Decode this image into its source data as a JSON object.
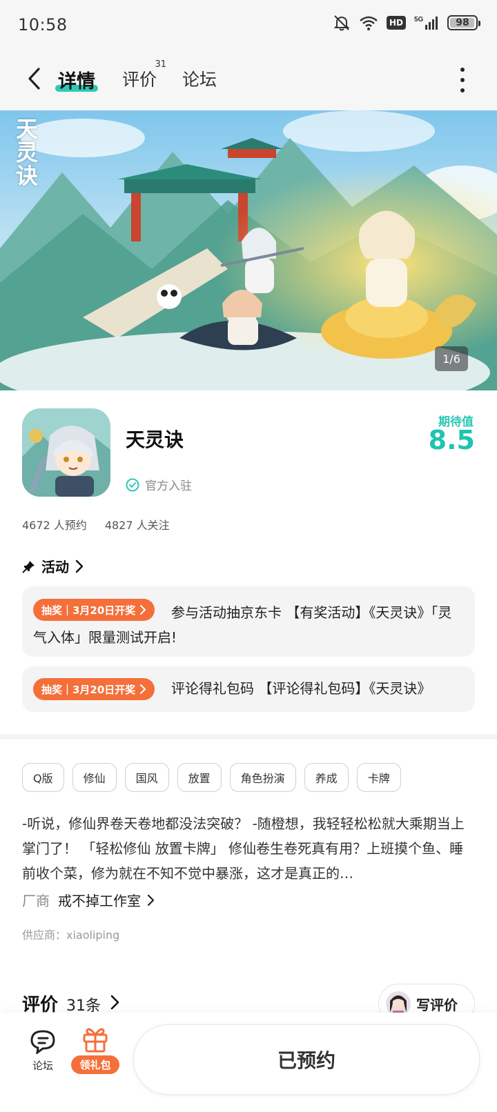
{
  "status_bar": {
    "time": "10:58",
    "network": "5G",
    "hd_label": "HD",
    "battery": "98",
    "battery_level_percent": 98,
    "icons": [
      "mute-bell-icon",
      "wifi-icon",
      "hd-icon",
      "signal-icon",
      "battery-icon"
    ]
  },
  "nav": {
    "tabs": [
      {
        "label": "详情",
        "active": true
      },
      {
        "label": "评价",
        "badge": "31"
      },
      {
        "label": "论坛"
      }
    ]
  },
  "banner": {
    "logo_text": "天灵诀",
    "counter": "1/6"
  },
  "app": {
    "name": "天灵诀",
    "official_label": "官方入驻",
    "score_label": "期待值",
    "score": "8.5",
    "stats": {
      "reservations": "4672 人预约",
      "followers": "4827 人关注"
    }
  },
  "activity": {
    "title": "活动",
    "items": [
      {
        "pill": "抽奖｜3月20日开奖",
        "text": "参与活动抽京东卡 【有奖活动】《天灵诀》「灵气入体」限量测试开启!"
      },
      {
        "pill": "抽奖｜3月20日开奖",
        "text": "评论得礼包码 【评论得礼包码】《天灵诀》"
      }
    ]
  },
  "tags": [
    "Q版",
    "修仙",
    "国风",
    "放置",
    "角色扮演",
    "养成",
    "卡牌"
  ],
  "description": "-听说，修仙界卷天卷地都没法突破？ -随橙想，我轻轻松松就大乘期当上掌门了！ 「轻松修仙 放置卡牌」 修仙卷生卷死真有用？上班摸个鱼、睡前收个菜，修为就在不知不觉中暴涨，这才是真正的…",
  "vendor": {
    "label": "厂商",
    "name": "戒不掉工作室"
  },
  "supplier": "供应商：xiaoliping",
  "reviews": {
    "title": "评价",
    "count": "31条",
    "write_label": "写评价"
  },
  "bottom_bar": {
    "forum_label": "论坛",
    "gift_label": "领礼包",
    "main_button": "已预约"
  },
  "colors": {
    "accent_teal": "#2ec8b7",
    "accent_orange": "#f46f3a"
  }
}
